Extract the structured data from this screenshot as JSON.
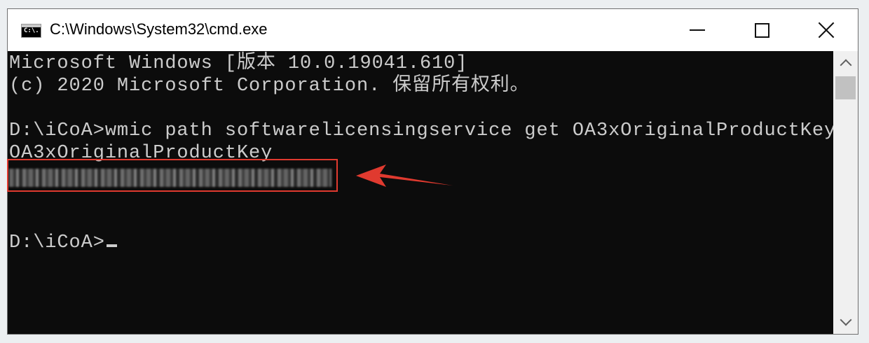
{
  "window": {
    "title": "C:\\Windows\\System32\\cmd.exe",
    "icon_label": "C:\\."
  },
  "console": {
    "lines": [
      "Microsoft Windows [版本 10.0.19041.610]",
      "(c) 2020 Microsoft Corporation. 保留所有权利。",
      "D:\\iCoA>wmic path softwarelicensingservice get OA3xOriginalProductKey",
      "OA3xOriginalProductKey",
      "D:\\iCoA>"
    ]
  },
  "annotation": {
    "highlight_color": "#e03a2f",
    "arrow_color": "#e03a2f"
  },
  "icons": {
    "minimize": "minimize-icon",
    "maximize": "maximize-icon",
    "close": "close-icon",
    "scroll_up": "chevron-up-icon",
    "scroll_down": "chevron-down-icon"
  }
}
